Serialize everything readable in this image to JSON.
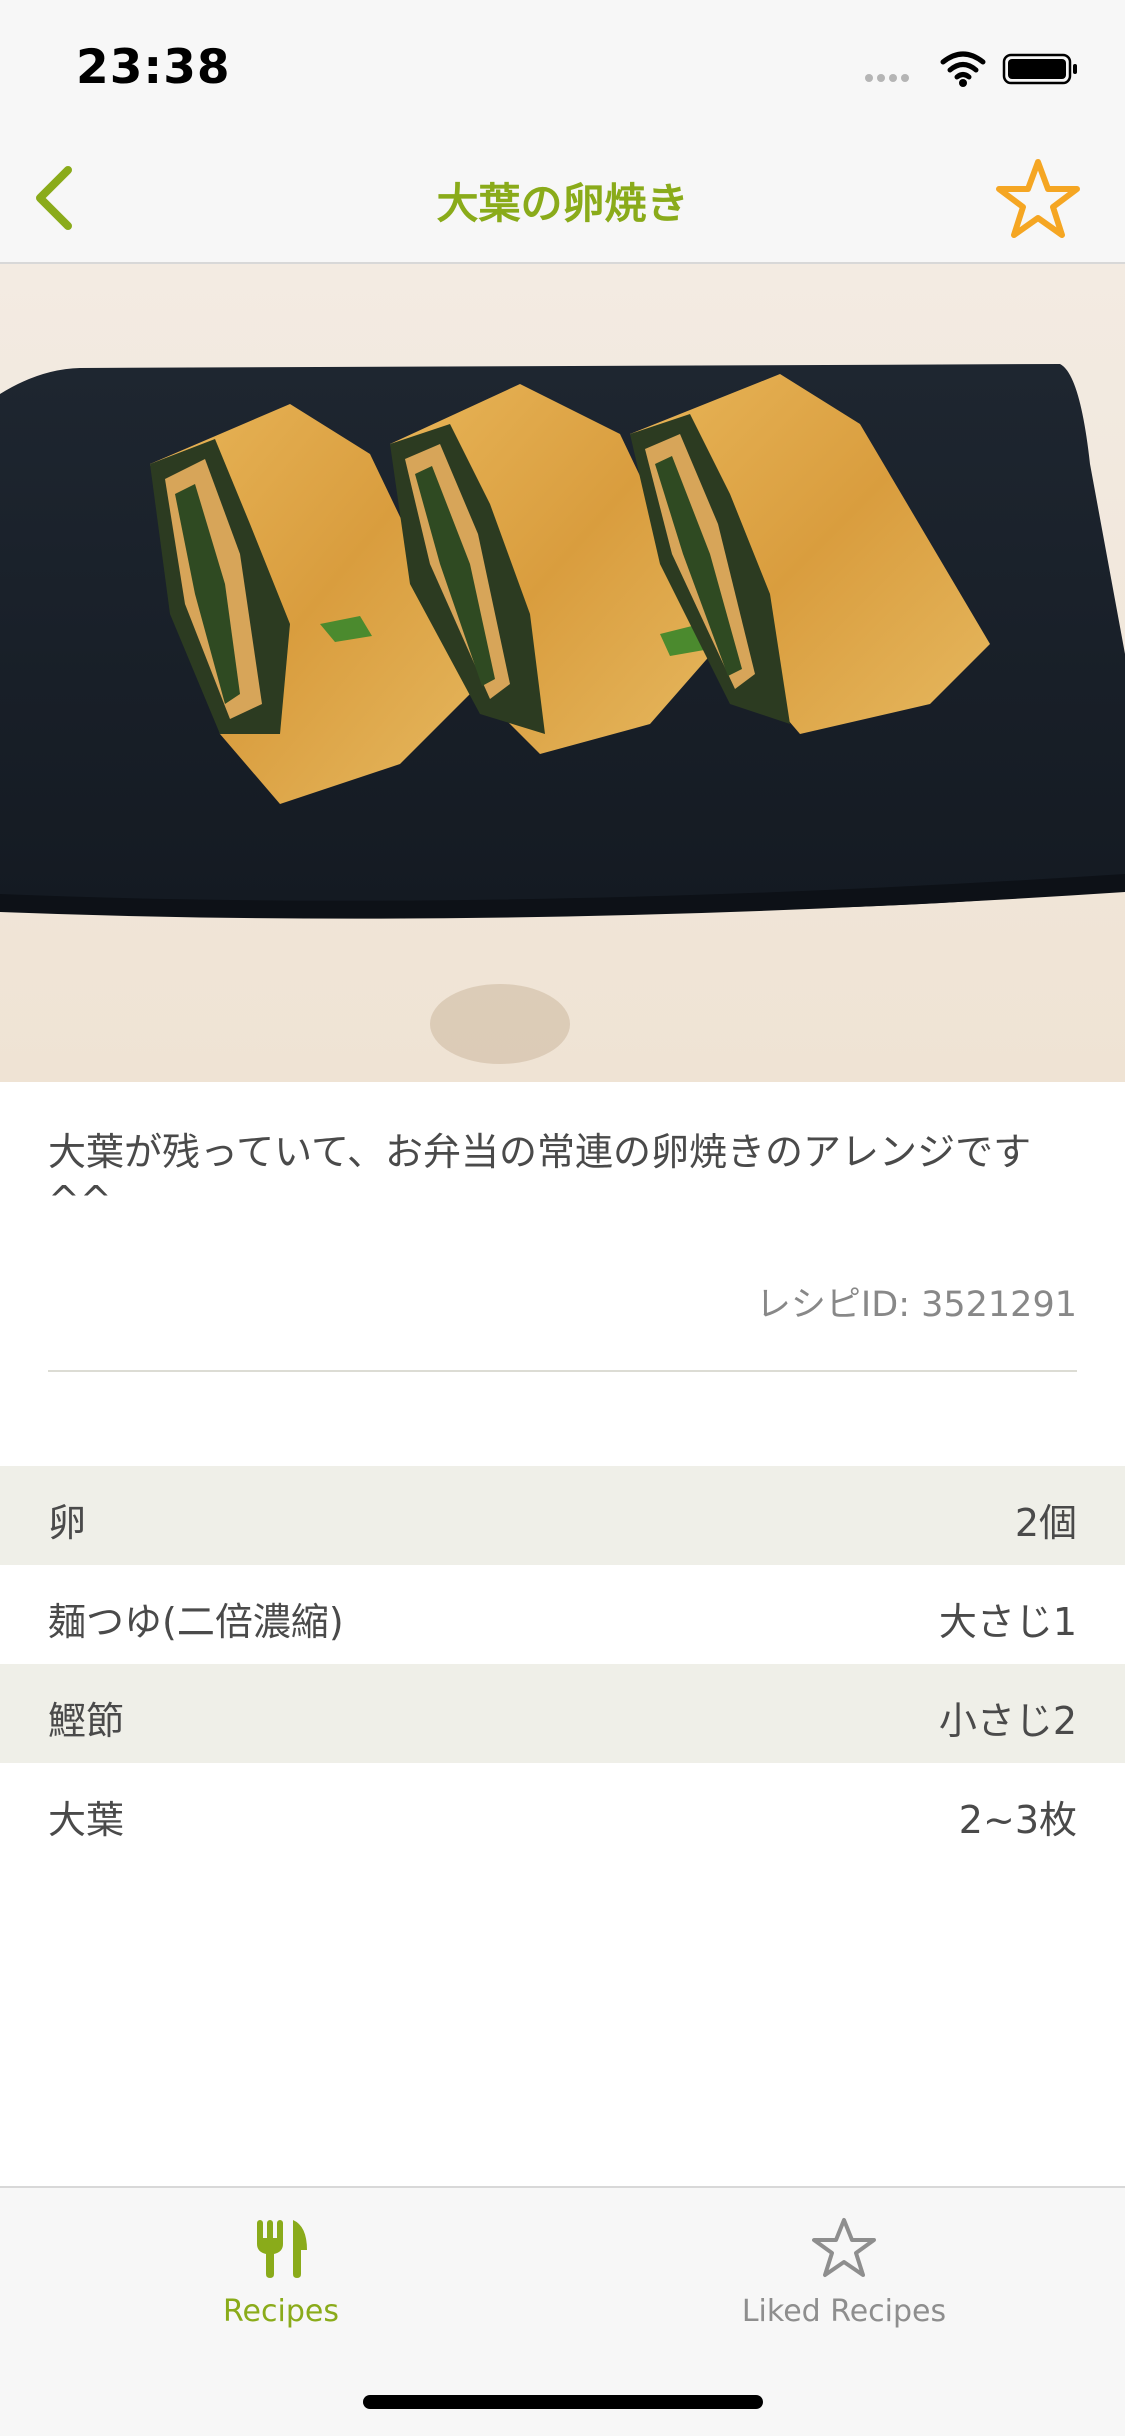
{
  "status_bar": {
    "time": "23:38"
  },
  "nav": {
    "title": "大葉の卵焼き",
    "back_icon": "chevron-left-icon",
    "favorite_icon": "star-outline-icon"
  },
  "recipe": {
    "description": "大葉が残っていて、お弁当の常連の卵焼きのアレンジです^^",
    "recipe_id_label": "レシピID: 3521291",
    "photo_alt": "大葉の卵焼き"
  },
  "ingredients": [
    {
      "name": "卵",
      "amount": "2個"
    },
    {
      "name": "麺つゆ(二倍濃縮)",
      "amount": "大さじ1"
    },
    {
      "name": "鰹節",
      "amount": "小さじ2"
    },
    {
      "name": "大葉",
      "amount": "2~3枚"
    }
  ],
  "tab_bar": {
    "tabs": [
      {
        "label": "Recipes",
        "icon": "fork-knife-icon",
        "selected": true
      },
      {
        "label": "Liked Recipes",
        "icon": "star-outline-icon",
        "selected": false
      }
    ]
  },
  "colors": {
    "accent_green": "#8aab1a",
    "favorite_orange": "#f5a623",
    "row_shade": "#efefe8",
    "inactive_gray": "#8e8e8e"
  }
}
